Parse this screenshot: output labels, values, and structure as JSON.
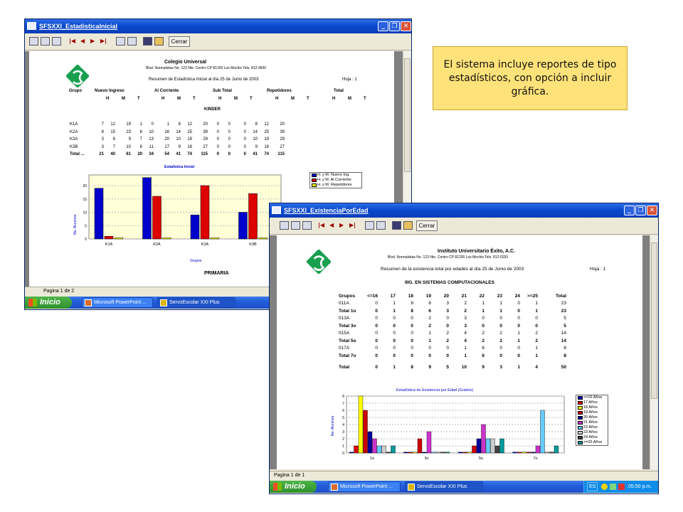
{
  "callout": {
    "text": "El sistema incluye reportes de tipo estadísticos, con opción a incluir gráfica."
  },
  "window1": {
    "title": "SFSXXI_EstadisticaInicial",
    "close_button": "Cerrar",
    "status": "Pagina 1 de 2",
    "report": {
      "school": "Colegio Universal",
      "address": "Blvd. Normalistas No. 123 Nte. Centro CP 81200 Los Mochis Tels. 812-9600",
      "subtitle": "Resumen de Estadística Inicial al día 25 de Junio de 2003",
      "page": "Hoja : 1",
      "groups": [
        "Grupo",
        "Nuevo Ingreso",
        "Al Corriente",
        "Sub Total",
        "Repetidores",
        "Total"
      ],
      "hmt": [
        "H",
        "M",
        "T"
      ],
      "section": "KINDER",
      "section2": "PRIMARIA",
      "rows": [
        [
          "K1A",
          "7",
          "12",
          "19",
          "1",
          "0",
          "1",
          "8",
          "12",
          "20",
          "0",
          "0",
          "0",
          "8",
          "12",
          "20"
        ],
        [
          "K2A",
          "8",
          "15",
          "23",
          "6",
          "10",
          "16",
          "14",
          "25",
          "39",
          "0",
          "0",
          "0",
          "14",
          "25",
          "39"
        ],
        [
          "K3A",
          "3",
          "6",
          "9",
          "7",
          "13",
          "20",
          "10",
          "19",
          "29",
          "0",
          "0",
          "0",
          "10",
          "19",
          "29"
        ],
        [
          "K3B",
          "3",
          "7",
          "10",
          "6",
          "11",
          "17",
          "9",
          "18",
          "27",
          "0",
          "0",
          "0",
          "9",
          "18",
          "27"
        ],
        [
          "Total ...",
          "21",
          "40",
          "61",
          "20",
          "34",
          "54",
          "41",
          "74",
          "115",
          "0",
          "0",
          "0",
          "41",
          "74",
          "115"
        ]
      ]
    },
    "chart": {
      "title": "Estadística Inicial",
      "ylabel": "No. Alumnos",
      "xlabel": "Grupos",
      "yticks": [
        "0",
        "5",
        "10",
        "15",
        "20"
      ],
      "legend": [
        "H. y M. Nuevo Ing.",
        "H. y M. Al Corriente",
        "H. y M. Repetidores"
      ]
    }
  },
  "window2": {
    "title": "SFSXXI_ExistenciaPorEdad",
    "close_button": "Cerrar",
    "status": "Pagina 1 de 1",
    "report": {
      "school": "Instituto Universitario Éxito, A.C.",
      "address": "Blvd. Normalistas No. 123 Nte. Centro CP 81200 Los Mochis Tels. 812-5253",
      "subtitle": "Resumen de la existencia total por edades al día 25 de Junio de 2003",
      "page": "Hoja : 1",
      "section": "IIIG. EN SISTEMAS COMPUTACIONALES",
      "header": [
        "Grupos",
        "<=16",
        "17",
        "18",
        "19",
        "20",
        "21",
        "22",
        "23",
        "24",
        ">=25",
        "Total"
      ],
      "rows": [
        [
          "011A",
          "0",
          "1",
          "8",
          "6",
          "3",
          "2",
          "1",
          "1",
          "0",
          "1",
          "23"
        ],
        [
          "Total 1o",
          "0",
          "1",
          "8",
          "6",
          "3",
          "2",
          "1",
          "1",
          "0",
          "1",
          "23"
        ],
        [
          "013A",
          "0",
          "0",
          "0",
          "2",
          "0",
          "3",
          "0",
          "0",
          "0",
          "0",
          "5"
        ],
        [
          "Total 3o",
          "0",
          "0",
          "0",
          "2",
          "0",
          "3",
          "0",
          "0",
          "0",
          "0",
          "5"
        ],
        [
          "015A",
          "0",
          "0",
          "0",
          "1",
          "2",
          "4",
          "2",
          "2",
          "1",
          "2",
          "14"
        ],
        [
          "Total 5o",
          "0",
          "0",
          "0",
          "1",
          "2",
          "4",
          "2",
          "2",
          "1",
          "2",
          "14"
        ],
        [
          "017A",
          "0",
          "0",
          "0",
          "0",
          "0",
          "1",
          "6",
          "0",
          "0",
          "1",
          "8"
        ],
        [
          "Total 7o",
          "0",
          "0",
          "0",
          "0",
          "0",
          "1",
          "6",
          "0",
          "0",
          "1",
          "8"
        ],
        [
          "Total",
          "0",
          "1",
          "8",
          "9",
          "5",
          "10",
          "9",
          "3",
          "1",
          "4",
          "50"
        ]
      ]
    },
    "chart": {
      "title": "Estadística de Existencia por Edad (Grados)",
      "ylabel": "No. Alumnos",
      "yticks": [
        "0",
        "1",
        "2",
        "3",
        "4",
        "5",
        "6",
        "7",
        "8"
      ],
      "categories": [
        "1o",
        "3o",
        "5o",
        "7o"
      ],
      "legend": [
        "<=16 Años",
        "17 Años",
        "18 Años",
        "19 Años",
        "20 Años",
        "21 Años",
        "22 Años",
        "23 Años",
        "24 Años",
        ">=25 Años"
      ]
    }
  },
  "taskbar": {
    "start": "Inicio",
    "task1": "Microsoft PowerPoint ...",
    "task2": "ServoEscolar XXI Plus",
    "lang": "ES",
    "clock": "05:50 p.m."
  },
  "colors": {
    "blue": "#0000cc",
    "red": "#dd0000",
    "yellow": "#ffff00",
    "ages": [
      "#0000cc",
      "#dd0000",
      "#ffff00",
      "#cc0000",
      "#000099",
      "#cc33cc",
      "#66ccff",
      "#cccccc",
      "#444444",
      "#009999"
    ]
  }
}
